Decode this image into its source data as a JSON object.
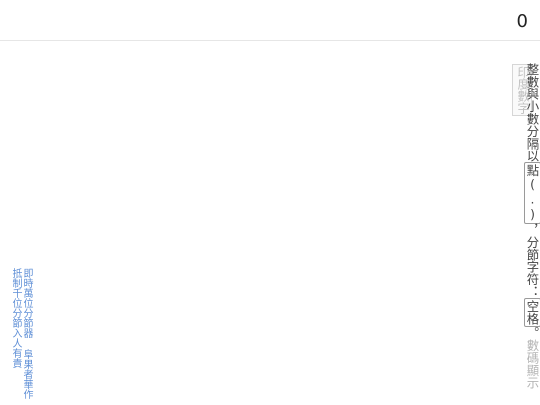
{
  "display": {
    "value": "0"
  },
  "sidebar": {
    "title": "印度數字"
  },
  "instructions": {
    "part1": "整數與小數分隔以",
    "key1": "點(.)",
    "part2": "，分節字符：",
    "key2": "空格",
    "part3": "。",
    "hint": "數碼顯示"
  },
  "credits": {
    "line1": "抵制千位分節入人有責",
    "line2": "即時萬位分節器 阜果者華作"
  }
}
